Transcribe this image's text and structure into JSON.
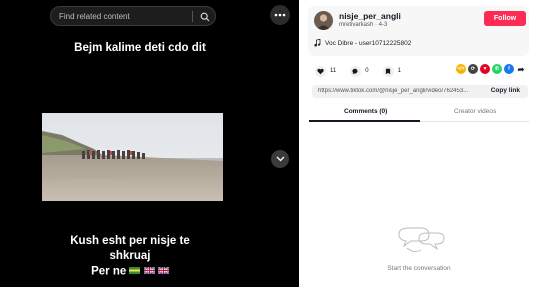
{
  "video": {
    "search_placeholder": "Find related content",
    "overlay_top": "Bejm kalime deti cdo dit",
    "overlay_bottom_line1": "Kush esht per nisje te",
    "overlay_bottom_line2": "shkruaj",
    "overlay_bottom_line3": "Per ne",
    "overlay_emojis": "🇮🇹🇬🇧🇬🇧"
  },
  "author": {
    "username": "nisje_per_angli",
    "subline": "mretivarkash · 4-3",
    "follow_label": "Follow",
    "music": "Voc Dibre - user10712225802"
  },
  "actions": {
    "likes": "11",
    "comments": "0",
    "saves": "1"
  },
  "share_icons": [
    "embed-icon",
    "repost-icon",
    "pinterest-icon",
    "whatsapp-icon",
    "facebook-icon",
    "share-arrow-icon"
  ],
  "link": {
    "url": "https://www.tiktok.com/@nisje_per_angli/video/762453...",
    "copy_label": "Copy link"
  },
  "tabs": {
    "comments": "Comments (0)",
    "creator": "Creator videos"
  },
  "empty": {
    "text": "Start the conversation"
  },
  "colors": {
    "follow": "#fe2c55",
    "whatsapp": "#25d366",
    "facebook": "#1877f2",
    "pinterest": "#e60023"
  }
}
